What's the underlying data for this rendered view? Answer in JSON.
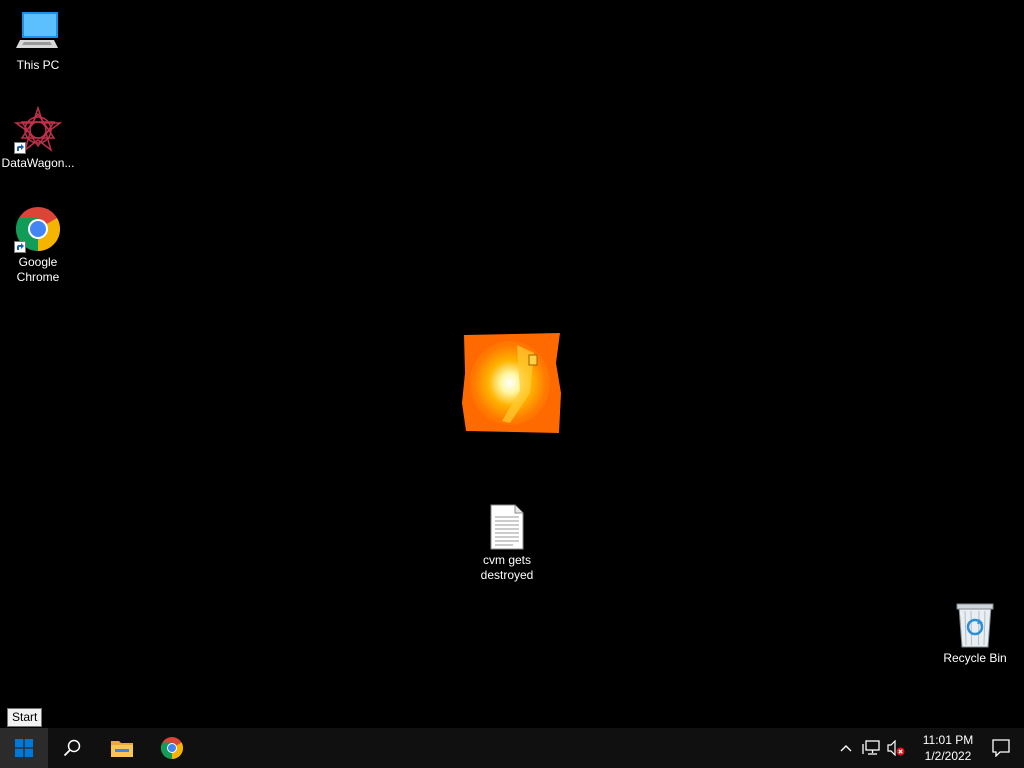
{
  "desktop": {
    "icons": [
      {
        "label": "This PC",
        "icon": "this-pc-icon"
      },
      {
        "label": "DataWagon...",
        "icon": "datawagon-icon"
      },
      {
        "label": "Google\nChrome",
        "icon": "chrome-icon"
      },
      {
        "label": "cvm gets\ndestroyed",
        "icon": "text-document-icon"
      },
      {
        "label": "Recycle Bin",
        "icon": "recycle-bin-icon"
      }
    ],
    "center_image": "fire-explosion-image"
  },
  "tooltip": {
    "text": "Start"
  },
  "taskbar": {
    "start_icon": "windows-logo-icon",
    "search_icon": "search-icon",
    "pinned": [
      {
        "name": "File Explorer",
        "icon": "folder-icon"
      },
      {
        "name": "Google Chrome",
        "icon": "chrome-icon"
      }
    ],
    "tray": {
      "chevron_icon": "chevron-up-icon",
      "network_icon": "network-icon",
      "volume_icon": "volume-muted-icon",
      "time": "11:01 PM",
      "date": "1/2/2022",
      "notifications_icon": "action-center-icon"
    }
  },
  "colors": {
    "desktop_background": "#000000",
    "taskbar_background": "#101010",
    "start_active": "#2b2b2b",
    "windows_blue": "#0078d7"
  }
}
